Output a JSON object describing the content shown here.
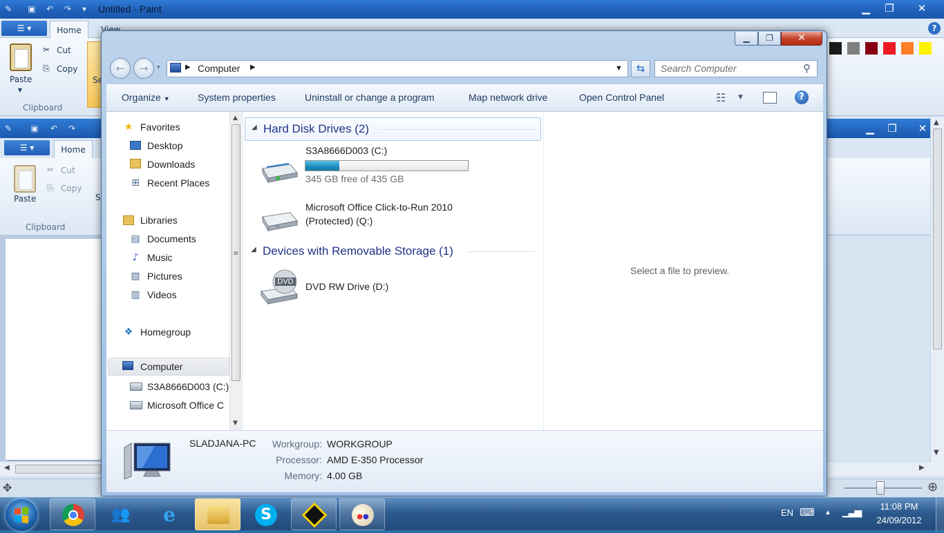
{
  "paint": {
    "title": "Untitled - Paint",
    "tabs": [
      "Home",
      "View"
    ],
    "paste_label": "Paste",
    "cut_label": "Cut",
    "copy_label": "Copy",
    "clipboard_label": "Clipboard",
    "select_label": "Se"
  },
  "paint2": {
    "home_tab": "Home",
    "paste_label": "Paste",
    "cut_label": "Cut",
    "copy_label": "Copy",
    "clipboard_label": "Clipboard",
    "s_label": "S"
  },
  "explorer": {
    "address": {
      "crumb": "Computer"
    },
    "search": {
      "placeholder": "Search Computer"
    },
    "commands": {
      "organize": "Organize",
      "system_properties": "System properties",
      "uninstall": "Uninstall or change a program",
      "map_drive": "Map network drive",
      "control_panel": "Open Control Panel"
    },
    "nav": {
      "favorites": "Favorites",
      "desktop": "Desktop",
      "downloads": "Downloads",
      "recent": "Recent Places",
      "libraries": "Libraries",
      "documents": "Documents",
      "music": "Music",
      "pictures": "Pictures",
      "videos": "Videos",
      "homegroup": "Homegroup",
      "computer": "Computer",
      "drive_c": "S3A8666D003 (C:)",
      "drive_q": "Microsoft Office C"
    },
    "groups": {
      "hdd": "Hard Disk Drives (2)",
      "removable": "Devices with Removable Storage (1)"
    },
    "drives": {
      "c_name": "S3A8666D003 (C:)",
      "c_free": "345 GB free of 435 GB",
      "c_used_fraction": 0.207,
      "q_name_line1": "Microsoft Office Click-to-Run 2010",
      "q_name_line2": "(Protected) (Q:)",
      "d_name": "DVD RW Drive (D:)",
      "dvd_label": "DVD"
    },
    "preview_text": "Select a file to preview.",
    "details": {
      "pc_name": "SLADJANA-PC",
      "workgroup_label": "Workgroup:",
      "workgroup_value": "WORKGROUP",
      "processor_label": "Processor:",
      "processor_value": "AMD E-350 Processor",
      "memory_label": "Memory:",
      "memory_value": "4.00 GB"
    }
  },
  "taskbar": {
    "apps": [
      "chrome-icon",
      "people-icon",
      "ie-icon",
      "explorer-icon",
      "skype-icon",
      "app-icon",
      "paint-icon"
    ],
    "language": "EN",
    "time": "11:08 PM",
    "date": "24/09/2012"
  },
  "colors": {
    "accent": "#1f5fb8",
    "group_header": "#1e3287",
    "progress": "#26a0da"
  }
}
